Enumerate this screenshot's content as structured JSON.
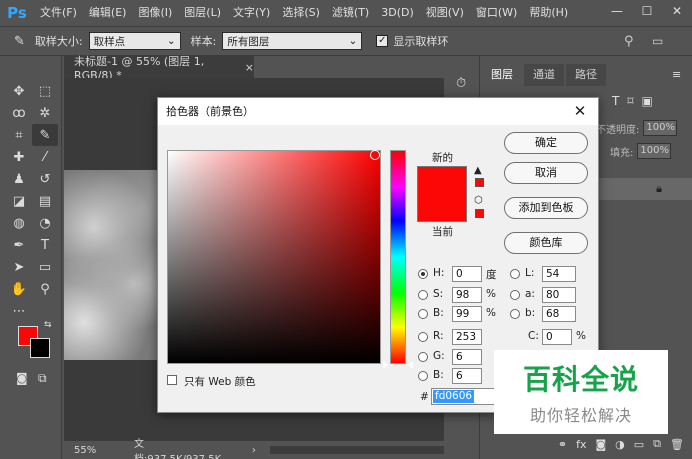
{
  "app": {
    "logo": "Ps"
  },
  "menu": [
    "文件(F)",
    "编辑(E)",
    "图像(I)",
    "图层(L)",
    "文字(Y)",
    "选择(S)",
    "滤镜(T)",
    "3D(D)",
    "视图(V)",
    "窗口(W)",
    "帮助(H)"
  ],
  "window_controls": {
    "minimize": "—",
    "restore": "☐",
    "close": "✕"
  },
  "options_bar": {
    "sample_size_label": "取样大小:",
    "sample_size_value": "取样点",
    "sample_label": "样本:",
    "sample_value": "所有图层",
    "show_ring_label": "显示取样环",
    "show_ring_checked": "✓"
  },
  "document": {
    "tab_title": "未标题-1 @ 55% (图层 1, RGB/8) *",
    "tab_close": "×"
  },
  "statusbar": {
    "zoom": "55%",
    "doc_info": "文档:937.5K/937.5K"
  },
  "panels": {
    "tabs": [
      "图层",
      "通道",
      "路径"
    ],
    "opacity_label": "不透明度:",
    "opacity_value": "100%",
    "fill_label": "填充:",
    "fill_value": "100%"
  },
  "color_picker": {
    "title": "拾色器（前景色）",
    "close": "✕",
    "new_label": "新的",
    "current_label": "当前",
    "buttons": {
      "ok": "确定",
      "cancel": "取消",
      "add_swatch": "添加到色板",
      "libraries": "颜色库"
    },
    "hsb": {
      "h_label": "H:",
      "h_value": "0",
      "h_unit": "度",
      "s_label": "S:",
      "s_value": "98",
      "s_unit": "%",
      "b_label": "B:",
      "b_value": "99",
      "b_unit": "%"
    },
    "rgb": {
      "r_label": "R:",
      "r_value": "253",
      "g_label": "G:",
      "g_value": "6",
      "b_label": "B:",
      "b_value": "6"
    },
    "lab": {
      "l_label": "L:",
      "l_value": "54",
      "a_label": "a:",
      "a_value": "80",
      "b_label": "b:",
      "b_value": "68"
    },
    "cmyk": {
      "c_label": "C:",
      "c_value": "0",
      "c_unit": "%"
    },
    "web_only_label": "只有 Web 颜色",
    "hex_label": "#",
    "hex_value": "fd0606",
    "selected_color": "#fd0606"
  },
  "watermark": {
    "title": "百科全说",
    "subtitle": "助你轻松解决"
  }
}
